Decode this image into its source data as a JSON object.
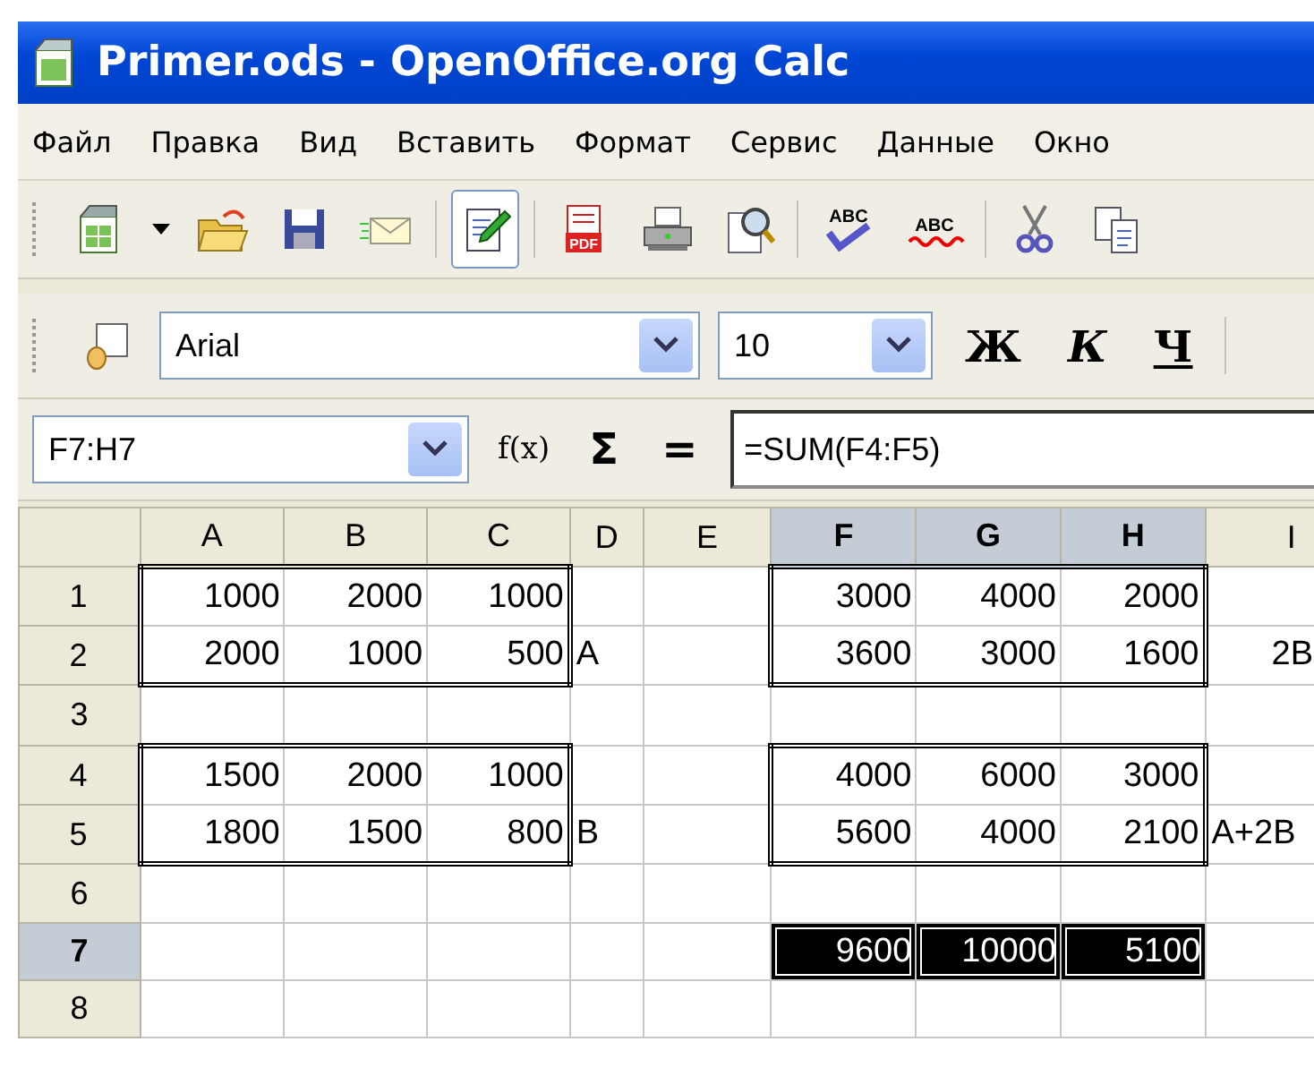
{
  "window": {
    "title": "Primer.ods - OpenOffice.org Calc"
  },
  "menu": [
    "Файл",
    "Правка",
    "Вид",
    "Вставить",
    "Формат",
    "Сервис",
    "Данные",
    "Окно"
  ],
  "toolbar": [
    {
      "kind": "new"
    },
    {
      "kind": "caret"
    },
    {
      "kind": "open"
    },
    {
      "kind": "save"
    },
    {
      "kind": "mail"
    },
    {
      "kind": "sep"
    },
    {
      "kind": "edit",
      "on": true
    },
    {
      "kind": "sep"
    },
    {
      "kind": "pdf",
      "text": "PDF"
    },
    {
      "kind": "print"
    },
    {
      "kind": "preview"
    },
    {
      "kind": "sep"
    },
    {
      "kind": "spell",
      "text": "ABC"
    },
    {
      "kind": "autospell",
      "text": "ABC"
    },
    {
      "kind": "sep"
    },
    {
      "kind": "cut"
    },
    {
      "kind": "copy"
    }
  ],
  "format_bar": {
    "font": "Arial",
    "size": "10",
    "bold": "Ж",
    "italic": "К",
    "underline": "Ч"
  },
  "formula_bar": {
    "name_box": "F7:H7",
    "function_wizard": "f(x)",
    "sum": "Σ",
    "equals": "=",
    "formula": "=SUM(F4:F5)"
  },
  "columns": [
    {
      "label": "A",
      "selected": false
    },
    {
      "label": "B",
      "selected": false
    },
    {
      "label": "C",
      "selected": false
    },
    {
      "label": "D",
      "selected": false
    },
    {
      "label": "E",
      "selected": false
    },
    {
      "label": "F",
      "selected": true
    },
    {
      "label": "G",
      "selected": true
    },
    {
      "label": "H",
      "selected": true
    },
    {
      "label": "I",
      "selected": false
    }
  ],
  "rows": [
    {
      "label": "1",
      "selected": false,
      "cells": [
        {
          "text": "1000",
          "kind": "number",
          "framed": true,
          "selected": false
        },
        {
          "text": "2000",
          "kind": "number",
          "framed": true,
          "selected": false
        },
        {
          "text": "1000",
          "kind": "number",
          "framed": true,
          "selected": false
        },
        {
          "selected": false
        },
        {
          "selected": false
        },
        {
          "text": "3000",
          "kind": "number",
          "framed": true,
          "selected": false
        },
        {
          "text": "4000",
          "kind": "number",
          "framed": true,
          "selected": false
        },
        {
          "text": "2000",
          "kind": "number",
          "framed": true,
          "selected": false
        },
        {
          "selected": false
        }
      ]
    },
    {
      "label": "2",
      "selected": false,
      "cells": [
        {
          "text": "2000",
          "kind": "number",
          "framed": true,
          "selected": false
        },
        {
          "text": "1000",
          "kind": "number",
          "framed": true,
          "selected": false
        },
        {
          "text": "500",
          "kind": "number",
          "framed": true,
          "selected": false
        },
        {
          "text": "A",
          "kind": "text",
          "selected": false
        },
        {
          "selected": false
        },
        {
          "text": "3600",
          "kind": "number",
          "framed": true,
          "selected": false
        },
        {
          "text": "3000",
          "kind": "number",
          "framed": true,
          "selected": false
        },
        {
          "text": "1600",
          "kind": "number",
          "framed": true,
          "selected": false
        },
        {
          "text": "2B",
          "kind": "center",
          "selected": false
        }
      ]
    },
    {
      "label": "3",
      "selected": false,
      "cells": [
        {
          "selected": false
        },
        {
          "selected": false
        },
        {
          "selected": false
        },
        {
          "selected": false
        },
        {
          "selected": false
        },
        {
          "selected": false
        },
        {
          "selected": false
        },
        {
          "selected": false
        },
        {
          "selected": false
        }
      ]
    },
    {
      "label": "4",
      "selected": false,
      "cells": [
        {
          "text": "1500",
          "kind": "number",
          "framed": true,
          "selected": false
        },
        {
          "text": "2000",
          "kind": "number",
          "framed": true,
          "selected": false
        },
        {
          "text": "1000",
          "kind": "number",
          "framed": true,
          "selected": false
        },
        {
          "selected": false
        },
        {
          "selected": false
        },
        {
          "text": "4000",
          "kind": "number",
          "framed": true,
          "selected": false
        },
        {
          "text": "6000",
          "kind": "number",
          "framed": true,
          "selected": false
        },
        {
          "text": "3000",
          "kind": "number",
          "framed": true,
          "selected": false
        },
        {
          "selected": false
        }
      ]
    },
    {
      "label": "5",
      "selected": false,
      "cells": [
        {
          "text": "1800",
          "kind": "number",
          "framed": true,
          "selected": false
        },
        {
          "text": "1500",
          "kind": "number",
          "framed": true,
          "selected": false
        },
        {
          "text": "800",
          "kind": "number",
          "framed": true,
          "selected": false
        },
        {
          "text": "B",
          "kind": "text",
          "selected": false
        },
        {
          "selected": false
        },
        {
          "text": "5600",
          "kind": "number",
          "framed": true,
          "selected": false
        },
        {
          "text": "4000",
          "kind": "number",
          "framed": true,
          "selected": false
        },
        {
          "text": "2100",
          "kind": "number",
          "framed": true,
          "selected": false
        },
        {
          "text": "A+2B",
          "kind": "text",
          "selected": false
        }
      ]
    },
    {
      "label": "6",
      "selected": false,
      "cells": [
        {
          "selected": false
        },
        {
          "selected": false
        },
        {
          "selected": false
        },
        {
          "selected": false
        },
        {
          "selected": false
        },
        {
          "selected": false
        },
        {
          "selected": false
        },
        {
          "selected": false
        },
        {
          "selected": false
        }
      ]
    },
    {
      "label": "7",
      "selected": true,
      "cells": [
        {
          "selected": false
        },
        {
          "selected": false
        },
        {
          "selected": false
        },
        {
          "selected": false
        },
        {
          "selected": false
        },
        {
          "text": "9600",
          "kind": "number",
          "selected": true
        },
        {
          "text": "10000",
          "kind": "number",
          "selected": true
        },
        {
          "text": "5100",
          "kind": "number",
          "selected": true
        },
        {
          "selected": false
        }
      ]
    },
    {
      "label": "8",
      "selected": false,
      "cells": [
        {
          "selected": false
        },
        {
          "selected": false
        },
        {
          "selected": false
        },
        {
          "selected": false
        },
        {
          "selected": false
        },
        {
          "selected": false
        },
        {
          "selected": false
        },
        {
          "selected": false
        },
        {
          "selected": false
        }
      ]
    }
  ]
}
